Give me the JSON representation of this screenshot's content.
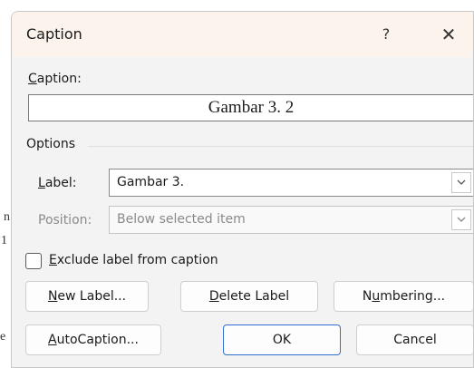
{
  "background": {
    "glyph1": "n",
    "glyph2": "1",
    "glyph3": "e"
  },
  "dialog": {
    "title": "Caption",
    "help": "?",
    "close": "✕"
  },
  "caption": {
    "label_mnemonic": "C",
    "label_rest": "aption:",
    "value": "Gambar 3. 2"
  },
  "options": {
    "heading": "Options",
    "label_field": {
      "label_mnemonic": "L",
      "label_rest": "abel:",
      "value": "Gambar 3."
    },
    "position_field": {
      "label": "Position:",
      "value": "Below selected item",
      "disabled": true
    }
  },
  "exclude": {
    "checked": false,
    "mnemonic": "E",
    "rest": "xclude label from caption"
  },
  "buttons": {
    "new_label": {
      "mnemonic": "N",
      "rest": "ew Label..."
    },
    "delete_label": {
      "mnemonic": "D",
      "rest": "elete Label"
    },
    "numbering": {
      "pre": "N",
      "mnemonic": "u",
      "rest": "mbering..."
    },
    "autocaption": {
      "mnemonic": "A",
      "rest": "utoCaption..."
    },
    "ok": "OK",
    "cancel": "Cancel"
  }
}
